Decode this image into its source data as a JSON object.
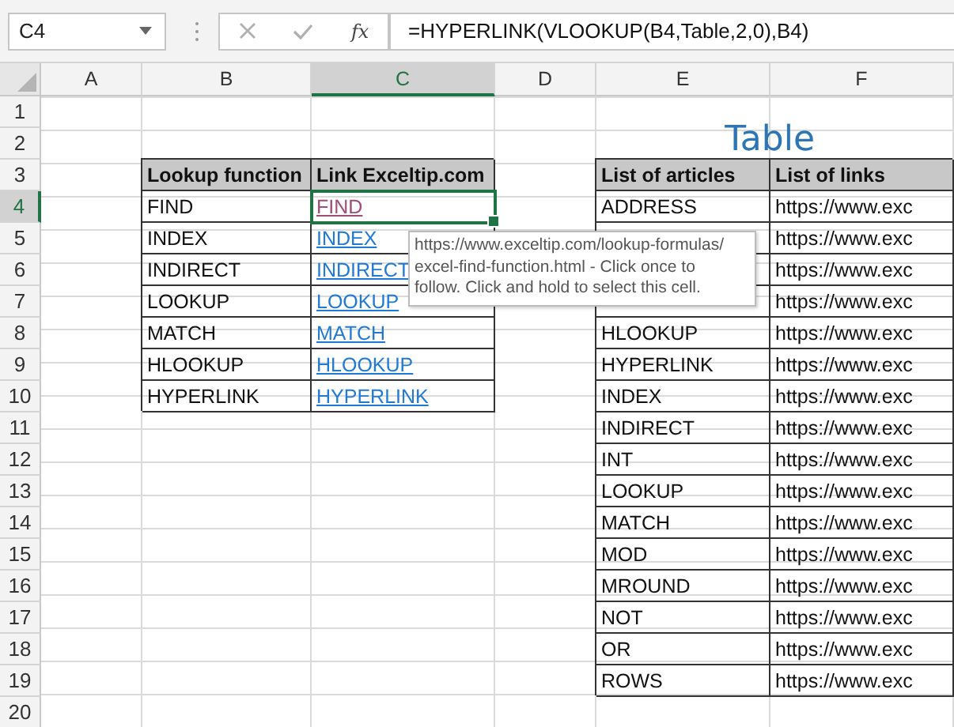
{
  "formula_bar": {
    "name_box": "C4",
    "function_label": "fx",
    "formula": "=HYPERLINK(VLOOKUP(B4,Table,2,0),B4)"
  },
  "columns": [
    {
      "label": "A",
      "selected": false
    },
    {
      "label": "B",
      "selected": false
    },
    {
      "label": "C",
      "selected": true
    },
    {
      "label": "D",
      "selected": false
    },
    {
      "label": "E",
      "selected": false
    },
    {
      "label": "F",
      "selected": false
    }
  ],
  "rows": [
    {
      "number": "1",
      "selected": false,
      "cells": [
        null,
        null,
        null,
        null,
        null,
        null
      ]
    },
    {
      "number": "2",
      "selected": false,
      "cells": [
        null,
        null,
        null,
        null,
        {
          "kind": "title",
          "text": "Table"
        },
        null
      ]
    },
    {
      "number": "3",
      "selected": false,
      "cells": [
        null,
        {
          "kind": "header",
          "text": "Lookup function"
        },
        {
          "kind": "header",
          "text": "Link Exceltip.com"
        },
        null,
        {
          "kind": "header",
          "text": "List of articles"
        },
        {
          "kind": "header",
          "text": "List of links"
        }
      ]
    },
    {
      "number": "4",
      "selected": true,
      "cells": [
        null,
        {
          "kind": "text",
          "text": "FIND"
        },
        {
          "kind": "link",
          "text": "FIND",
          "visited": true,
          "selected": true
        },
        null,
        {
          "kind": "text",
          "text": "ADDRESS"
        },
        {
          "kind": "text",
          "text": "https://www.exc"
        }
      ]
    },
    {
      "number": "5",
      "selected": false,
      "cells": [
        null,
        {
          "kind": "text",
          "text": "INDEX"
        },
        {
          "kind": "link",
          "text": "INDEX",
          "visited": false,
          "selected": false
        },
        null,
        {
          "kind": "blank"
        },
        {
          "kind": "text",
          "text": "https://www.exc"
        }
      ]
    },
    {
      "number": "6",
      "selected": false,
      "cells": [
        null,
        {
          "kind": "text",
          "text": "INDIRECT"
        },
        {
          "kind": "link",
          "text": "INDIRECT",
          "visited": false,
          "selected": false
        },
        null,
        {
          "kind": "blank"
        },
        {
          "kind": "text",
          "text": "https://www.exc"
        }
      ]
    },
    {
      "number": "7",
      "selected": false,
      "cells": [
        null,
        {
          "kind": "text",
          "text": "LOOKUP"
        },
        {
          "kind": "link",
          "text": "LOOKUP",
          "visited": false,
          "selected": false
        },
        null,
        {
          "kind": "blank"
        },
        {
          "kind": "text",
          "text": "https://www.exc"
        }
      ]
    },
    {
      "number": "8",
      "selected": false,
      "cells": [
        null,
        {
          "kind": "text",
          "text": "MATCH"
        },
        {
          "kind": "link",
          "text": "MATCH",
          "visited": false,
          "selected": false
        },
        null,
        {
          "kind": "text",
          "text": "HLOOKUP"
        },
        {
          "kind": "text",
          "text": "https://www.exc"
        }
      ]
    },
    {
      "number": "9",
      "selected": false,
      "cells": [
        null,
        {
          "kind": "text",
          "text": "HLOOKUP"
        },
        {
          "kind": "link",
          "text": "HLOOKUP",
          "visited": false,
          "selected": false
        },
        null,
        {
          "kind": "text",
          "text": "HYPERLINK"
        },
        {
          "kind": "text",
          "text": "https://www.exc"
        }
      ]
    },
    {
      "number": "10",
      "selected": false,
      "cells": [
        null,
        {
          "kind": "text",
          "text": "HYPERLINK"
        },
        {
          "kind": "link",
          "text": "HYPERLINK",
          "visited": false,
          "selected": false
        },
        null,
        {
          "kind": "text",
          "text": "INDEX"
        },
        {
          "kind": "text",
          "text": "https://www.exc"
        }
      ]
    },
    {
      "number": "11",
      "selected": false,
      "cells": [
        null,
        null,
        null,
        null,
        {
          "kind": "text",
          "text": "INDIRECT"
        },
        {
          "kind": "text",
          "text": "https://www.exc"
        }
      ]
    },
    {
      "number": "12",
      "selected": false,
      "cells": [
        null,
        null,
        null,
        null,
        {
          "kind": "text",
          "text": "INT"
        },
        {
          "kind": "text",
          "text": "https://www.exc"
        }
      ]
    },
    {
      "number": "13",
      "selected": false,
      "cells": [
        null,
        null,
        null,
        null,
        {
          "kind": "text",
          "text": "LOOKUP"
        },
        {
          "kind": "text",
          "text": "https://www.exc"
        }
      ]
    },
    {
      "number": "14",
      "selected": false,
      "cells": [
        null,
        null,
        null,
        null,
        {
          "kind": "text",
          "text": "MATCH"
        },
        {
          "kind": "text",
          "text": "https://www.exc"
        }
      ]
    },
    {
      "number": "15",
      "selected": false,
      "cells": [
        null,
        null,
        null,
        null,
        {
          "kind": "text",
          "text": "MOD"
        },
        {
          "kind": "text",
          "text": "https://www.exc"
        }
      ]
    },
    {
      "number": "16",
      "selected": false,
      "cells": [
        null,
        null,
        null,
        null,
        {
          "kind": "text",
          "text": "MROUND"
        },
        {
          "kind": "text",
          "text": "https://www.exc"
        }
      ]
    },
    {
      "number": "17",
      "selected": false,
      "cells": [
        null,
        null,
        null,
        null,
        {
          "kind": "text",
          "text": "NOT"
        },
        {
          "kind": "text",
          "text": "https://www.exc"
        }
      ]
    },
    {
      "number": "18",
      "selected": false,
      "cells": [
        null,
        null,
        null,
        null,
        {
          "kind": "text",
          "text": "OR"
        },
        {
          "kind": "text",
          "text": "https://www.exc"
        }
      ]
    },
    {
      "number": "19",
      "selected": false,
      "cells": [
        null,
        null,
        null,
        null,
        {
          "kind": "text",
          "text": "ROWS"
        },
        {
          "kind": "text",
          "text": "https://www.exc"
        }
      ]
    },
    {
      "number": "20",
      "selected": false,
      "cells": [
        null,
        null,
        null,
        null,
        null,
        null
      ]
    }
  ],
  "tooltip": {
    "text": "https://www.exceltip.com/lookup-formulas/\nexcel-find-function.html - Click once to\nfollow. Click and hold to select this cell."
  }
}
